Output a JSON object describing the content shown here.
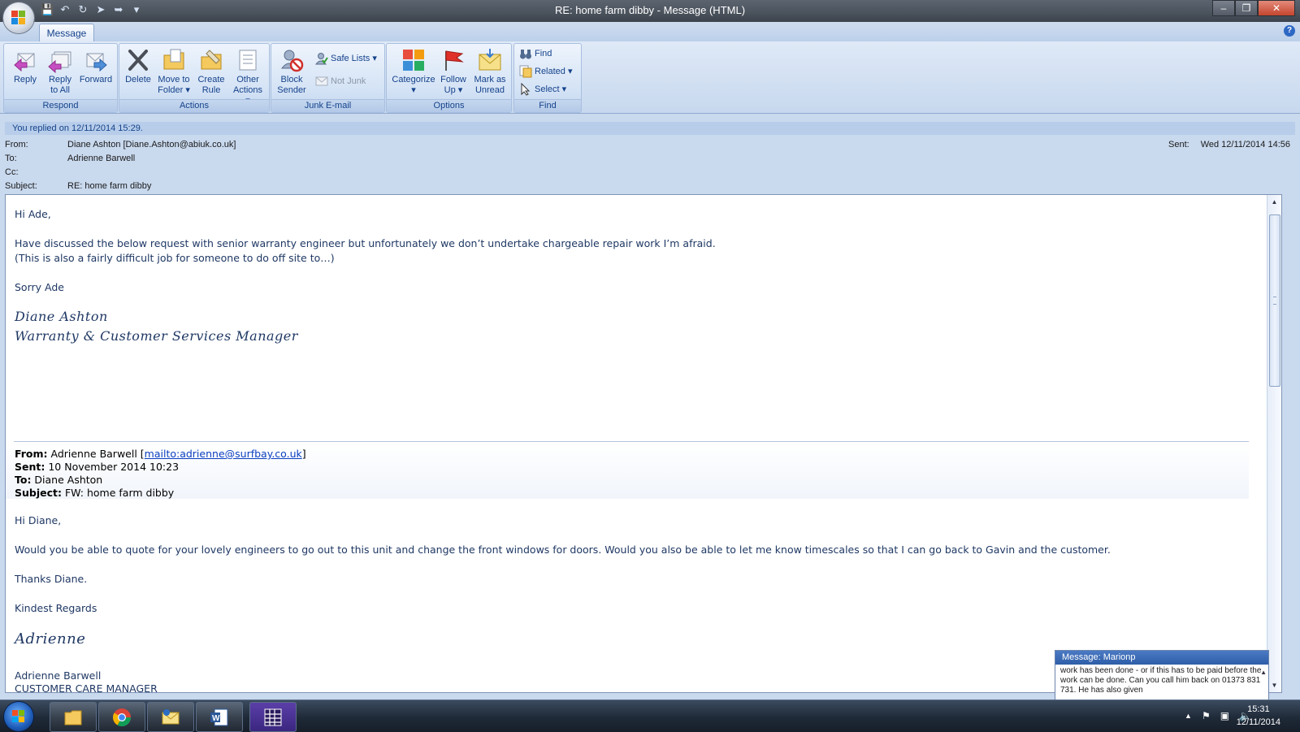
{
  "window": {
    "title": "RE: home farm dibby - Message (HTML)",
    "minimize": "–",
    "restore": "❐",
    "close": "✕"
  },
  "qat": {
    "save_icon": "save-icon",
    "undo_icon": "undo-icon",
    "redo_icon": "redo-icon",
    "prev_icon": "up-arrow-icon",
    "next_icon": "down-arrow-icon",
    "customize": "▾"
  },
  "tabs": {
    "message": "Message",
    "help": "?"
  },
  "ribbon": {
    "respond": {
      "label": "Respond",
      "reply": "Reply",
      "reply_all_1": "Reply",
      "reply_all_2": "to All",
      "forward": "Forward"
    },
    "actions": {
      "label": "Actions",
      "delete": "Delete",
      "move_1": "Move to",
      "move_2": "Folder",
      "rule_1": "Create",
      "rule_2": "Rule",
      "other_1": "Other",
      "other_2": "Actions"
    },
    "junk": {
      "label": "Junk E-mail",
      "block_1": "Block",
      "block_2": "Sender",
      "safe_lists": "Safe Lists",
      "not_junk": "Not Junk"
    },
    "options": {
      "label": "Options",
      "categorize": "Categorize",
      "follow_1": "Follow",
      "follow_2": "Up",
      "mark_1": "Mark as",
      "mark_2": "Unread"
    },
    "find": {
      "label": "Find",
      "find": "Find",
      "related": "Related",
      "select": "Select"
    },
    "dropdown_arrow": "▾"
  },
  "infobar": "You replied on 12/11/2014 15:29.",
  "header": {
    "from_label": "From:",
    "from_value": "Diane Ashton [Diane.Ashton@abiuk.co.uk]",
    "to_label": "To:",
    "to_value": "Adrienne Barwell",
    "cc_label": "Cc:",
    "cc_value": "",
    "subject_label": "Subject:",
    "subject_value": "RE: home farm dibby",
    "sent_label": "Sent:",
    "sent_value": "Wed 12/11/2014 14:56"
  },
  "body": {
    "greeting": "Hi Ade,",
    "line1": "Have discussed the below request with senior warranty engineer  but unfortunately we don’t undertake chargeable repair work I’m afraid.",
    "line2": "(This is also a fairly difficult job for someone to do off site to…)",
    "sorry": "Sorry Ade",
    "sig_name": "Diane Ashton",
    "sig_title": "Warranty & Customer Services Manager",
    "quoted": {
      "from_label": "From:",
      "from_value": " Adrienne Barwell [",
      "from_link": "mailto:adrienne@surfbay.co.uk",
      "from_close": "]",
      "sent_label": "Sent:",
      "sent_value": " 10 November 2014 10:23",
      "to_label": "To:",
      "to_value": " Diane Ashton",
      "subject_label": "Subject:",
      "subject_value": " FW: home farm dibby",
      "greeting": "Hi Diane,",
      "para": "Would you be able to quote for your lovely engineers to go out to this unit and change the front windows for doors.  Would you also be able to let me know timescales so that I can go back to Gavin and the customer.",
      "thanks": "Thanks Diane.",
      "regards": "Kindest Regards",
      "sig": "Adrienne",
      "name": "Adrienne Barwell",
      "role": "CUSTOMER CARE MANAGER"
    }
  },
  "notification": {
    "title": "Message: Marionp",
    "text": "work has been done - or if this has to be paid before the work can be done. Can you call him back on 01373 831 731. He has also given"
  },
  "taskbar": {
    "apps": [
      "explorer-icon",
      "chrome-icon",
      "outlook-icon",
      "word-icon",
      "calendar-icon"
    ],
    "tray_up": "▲",
    "time": "15:31",
    "date": "12/11/2014"
  },
  "colors": {
    "accent": "#15428b",
    "ribbon": "#c7d8ee",
    "body_text": "#1f3864"
  }
}
